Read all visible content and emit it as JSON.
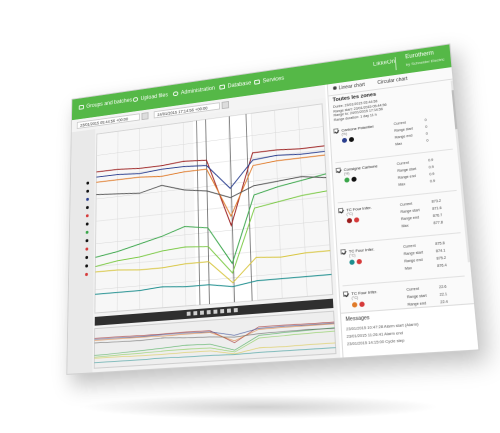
{
  "nav": {
    "items": [
      {
        "label": "Groups and batches"
      },
      {
        "label": "Upload files"
      },
      {
        "label": "Administration"
      },
      {
        "label": "Database"
      },
      {
        "label": "Services"
      }
    ],
    "brand_name": "LikkeOn",
    "brand_product": "Eurotherm",
    "brand_tagline": "by Schneider Electric"
  },
  "toolbar": {
    "start_date": "23/01/2015 05:44:56 +00:00",
    "end_date": "24/01/2015 17:14:56 +00:00"
  },
  "chart_data": {
    "type": "line",
    "title": "",
    "xlabel": "",
    "ylabel": "",
    "x": [
      0,
      10,
      20,
      30,
      40,
      50,
      60,
      70,
      80,
      90,
      100
    ],
    "ylim": [
      0,
      100
    ],
    "grid": true,
    "series": [
      {
        "color": "#9b1d1d",
        "values": [
          78,
          78,
          77,
          77,
          78,
          77,
          40,
          78,
          78,
          77,
          77
        ]
      },
      {
        "color": "#2b3f8f",
        "values": [
          75,
          75,
          74,
          75,
          75,
          74,
          60,
          74,
          75,
          74,
          74
        ]
      },
      {
        "color": "#e07b2a",
        "values": [
          72,
          72,
          72,
          71,
          72,
          72,
          45,
          71,
          72,
          72,
          72
        ]
      },
      {
        "color": "#3aa64a",
        "values": [
          30,
          32,
          35,
          38,
          42,
          40,
          20,
          55,
          58,
          60,
          62
        ]
      },
      {
        "color": "#7ac943",
        "values": [
          25,
          27,
          28,
          30,
          31,
          30,
          15,
          48,
          50,
          52,
          53
        ]
      },
      {
        "color": "#d8c640",
        "values": [
          22,
          22,
          21,
          21,
          22,
          22,
          10,
          22,
          21,
          22,
          22
        ]
      },
      {
        "color": "#555555",
        "values": [
          65,
          64,
          63,
          66,
          62,
          60,
          55,
          60,
          61,
          62,
          60
        ]
      },
      {
        "color": "#1f8f8f",
        "values": [
          10,
          10,
          10,
          11,
          10,
          10,
          8,
          10,
          10,
          10,
          10
        ]
      }
    ]
  },
  "panel": {
    "tabs": [
      {
        "label": "Linear chart",
        "active": true
      },
      {
        "label": "Circular chart",
        "active": false
      }
    ],
    "title": "Toutes les zones",
    "info_lines": [
      "Durée: 23/01/2015 05:44:56",
      "Range start: 23/01/2015 05:44:56",
      "Range to: 24/01/2015 17:14:56",
      "Range duration: 1 day 11 h"
    ],
    "cards": [
      {
        "name": "Carbone Potentiel",
        "unit": "(%)",
        "color": "#2b3f8f",
        "color2": "#111111",
        "stats": [
          [
            "Current",
            "0"
          ],
          [
            "Range start",
            "0"
          ],
          [
            "Range end",
            "0"
          ],
          [
            "Max",
            "0"
          ]
        ]
      },
      {
        "name": "Consigne Carbone",
        "unit": "(%)",
        "color": "#3aa64a",
        "color2": "#111111",
        "stats": [
          [
            "Current",
            "0.9"
          ],
          [
            "Range start",
            "0.9"
          ],
          [
            "Range end",
            "0.9"
          ],
          [
            "Max",
            "0.9"
          ]
        ]
      },
      {
        "name": "TC Four Infer.",
        "unit": "(°C)",
        "color": "#9b1d1d",
        "color2": "#d63a3a",
        "stats": [
          [
            "Current",
            "873.2"
          ],
          [
            "Range start",
            "871.6"
          ],
          [
            "Range end",
            "876.7"
          ],
          [
            "Max",
            "877.8"
          ]
        ]
      },
      {
        "name": "TC Four Infer.",
        "unit": "(°C)",
        "color": "#1f8f8f",
        "color2": "#d63a3a",
        "stats": [
          [
            "Current",
            "875.8"
          ],
          [
            "Range start",
            "874.1"
          ],
          [
            "Range end",
            "875.2"
          ],
          [
            "Max",
            "876.4"
          ]
        ]
      },
      {
        "name": "TC Four Infer.",
        "unit": "(°C)",
        "color": "#e07b2a",
        "color2": "#d63a3a",
        "stats": [
          [
            "Current",
            "22.6"
          ],
          [
            "Range start",
            "22.1"
          ],
          [
            "Range end",
            "22.4"
          ],
          [
            "Max",
            "23.0"
          ]
        ]
      }
    ],
    "messages_title": "Messages",
    "messages": [
      "23/01/2015 10:47:28 Alarm start (Alarm)",
      "23/01/2015 11:26:41 Alarm end",
      "23/01/2015 14:15:00 Cycle step"
    ]
  }
}
